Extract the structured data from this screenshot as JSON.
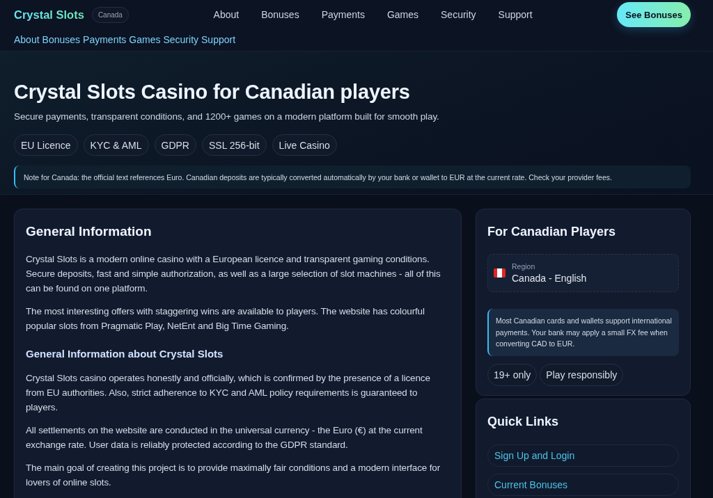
{
  "header": {
    "logo": "Crystal Slots",
    "badge": "Canada",
    "nav": [
      {
        "label": "About"
      },
      {
        "label": "Bonuses"
      },
      {
        "label": "Payments"
      },
      {
        "label": "Games"
      },
      {
        "label": "Security"
      },
      {
        "label": "Support"
      }
    ],
    "cta": "See Bonuses"
  },
  "secondary_nav": [
    {
      "label": "About"
    },
    {
      "label": "Bonuses"
    },
    {
      "label": "Payments"
    },
    {
      "label": "Games"
    },
    {
      "label": "Security"
    },
    {
      "label": "Support"
    }
  ],
  "hero": {
    "title": "Crystal Slots Casino for Canadian players",
    "subtitle": "Secure payments, transparent conditions, and 1200+ games on a modern platform built for smooth play.",
    "chips": [
      "EU Licence",
      "KYC & AML",
      "GDPR",
      "SSL 256-bit",
      "Live Casino"
    ],
    "note": "Note for Canada: the official text references Euro. Canadian deposits are typically converted automatically by your bank or wallet to EUR at the current rate. Check your provider fees."
  },
  "main": {
    "title": "General Information",
    "blocks": [
      {
        "kind": "paragraph",
        "text": "Crystal Slots is a modern online casino with a European licence and transparent gaming conditions. Secure deposits, fast and simple authorization, as well as a large selection of slot machines - all of this can be found on one platform."
      },
      {
        "kind": "paragraph",
        "text": "The most interesting offers with staggering wins are available to players. The website has colourful popular slots from Pragmatic Play, NetEnt and Big Time Gaming."
      },
      {
        "kind": "heading",
        "text": "General Information about Crystal Slots"
      },
      {
        "kind": "paragraph",
        "text": "Crystal Slots casino operates honestly and officially, which is confirmed by the presence of a licence from EU authorities. Also, strict adherence to KYC and AML policy requirements is guaranteed to players."
      },
      {
        "kind": "paragraph",
        "text": "All settlements on the website are conducted in the universal currency - the Euro (€) at the current exchange rate. User data is reliably protected according to the GDPR standard."
      },
      {
        "kind": "paragraph",
        "text": "The main goal of creating this project is to provide maximally fair conditions and a modern interface for lovers of online slots."
      }
    ]
  },
  "sidebar": {
    "canada_card": {
      "title": "For Canadian Players",
      "region": {
        "label": "Region",
        "value": "Canada - English"
      },
      "note": "Most Canadian cards and wallets support international payments. Your bank may apply a small FX fee when converting CAD to EUR.",
      "chips": [
        "19+ only",
        "Play responsibly"
      ]
    },
    "quick_links": {
      "title": "Quick Links",
      "links": [
        {
          "label": "Sign Up and Login"
        },
        {
          "label": "Current Bonuses"
        }
      ]
    }
  }
}
